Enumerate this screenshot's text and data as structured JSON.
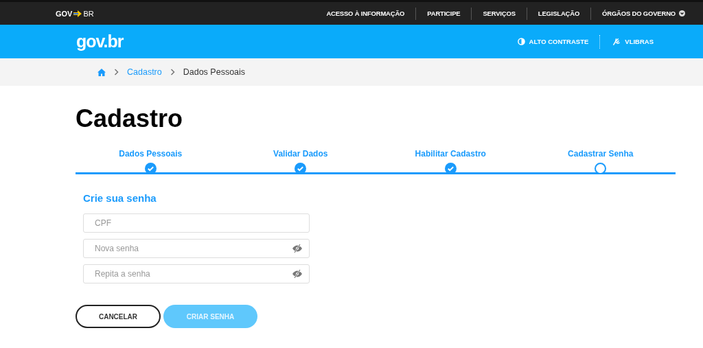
{
  "top_bar": {
    "logo": {
      "left": "GOV",
      "right": "BR"
    },
    "links": [
      {
        "label": "ACESSO À INFORMAÇÃO",
        "has_menu": false
      },
      {
        "label": "PARTICIPE",
        "has_menu": false
      },
      {
        "label": "SERVIÇOS",
        "has_menu": false
      },
      {
        "label": "LEGISLAÇÃO",
        "has_menu": false
      },
      {
        "label": "ÓRGÃOS DO GOVERNO",
        "has_menu": true
      }
    ]
  },
  "header": {
    "logo": "gov.br",
    "actions": [
      {
        "kind": "contrast",
        "label": "ALTO CONTRASTE"
      },
      {
        "kind": "libras",
        "label": "VLIBRAS"
      }
    ]
  },
  "breadcrumb": [
    {
      "kind": "home"
    },
    {
      "kind": "link",
      "label": "Cadastro"
    },
    {
      "kind": "current",
      "label": "Dados Pessoais"
    }
  ],
  "title": "Cadastro",
  "steps": [
    {
      "label": "Dados Pessoais",
      "done": true
    },
    {
      "label": "Validar Dados",
      "done": true
    },
    {
      "label": "Habilitar Cadastro",
      "done": true
    },
    {
      "label": "Cadastrar Senha",
      "done": false
    }
  ],
  "form": {
    "heading": "Crie sua senha",
    "fields": [
      {
        "kind": "text",
        "placeholder": "CPF"
      },
      {
        "kind": "password",
        "placeholder": "Nova senha"
      },
      {
        "kind": "password",
        "placeholder": "Repita a senha"
      }
    ]
  },
  "buttons": [
    {
      "kind": "secondary",
      "label": "CANCELAR",
      "disabled": false
    },
    {
      "kind": "primary",
      "label": "CRIAR SENHA",
      "disabled": true
    }
  ]
}
